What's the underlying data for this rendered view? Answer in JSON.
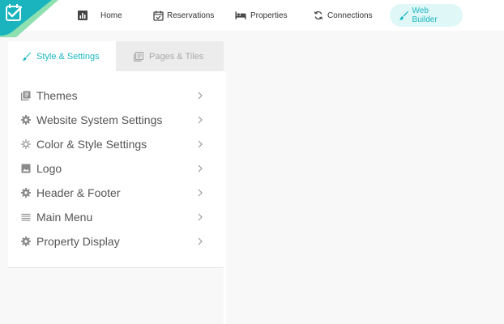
{
  "colors": {
    "accent": "#1bb7c0",
    "accent_bg": "#dff7f7",
    "logo_teal": "#19b4bd",
    "logo_green": "#8fe0b0",
    "icon_gray": "#8a8a8a",
    "nav_icon": "#444444"
  },
  "topnav": {
    "items": [
      {
        "label": "Home",
        "icon": "bar-chart-icon"
      },
      {
        "label": "Reservations",
        "icon": "calendar-check-icon"
      },
      {
        "label": "Properties",
        "icon": "bed-icon"
      },
      {
        "label": "Connections",
        "icon": "sync-icon"
      },
      {
        "label": "Web Builder",
        "icon": "brush-icon",
        "active": true
      }
    ]
  },
  "tabs": {
    "style": {
      "label": "Style & Settings",
      "icon": "brush-icon",
      "active": true
    },
    "pages": {
      "label": "Pages & Tiles",
      "icon": "library-icon"
    }
  },
  "menu": {
    "items": [
      {
        "label": "Themes",
        "icon": "library-icon"
      },
      {
        "label": "Website System Settings",
        "icon": "gear-icon"
      },
      {
        "label": "Color & Style Settings",
        "icon": "brightness-icon"
      },
      {
        "label": "Logo",
        "icon": "image-icon"
      },
      {
        "label": "Header & Footer",
        "icon": "gear-icon"
      },
      {
        "label": "Main Menu",
        "icon": "lines-icon"
      },
      {
        "label": "Property Display",
        "icon": "gear-icon"
      }
    ]
  }
}
